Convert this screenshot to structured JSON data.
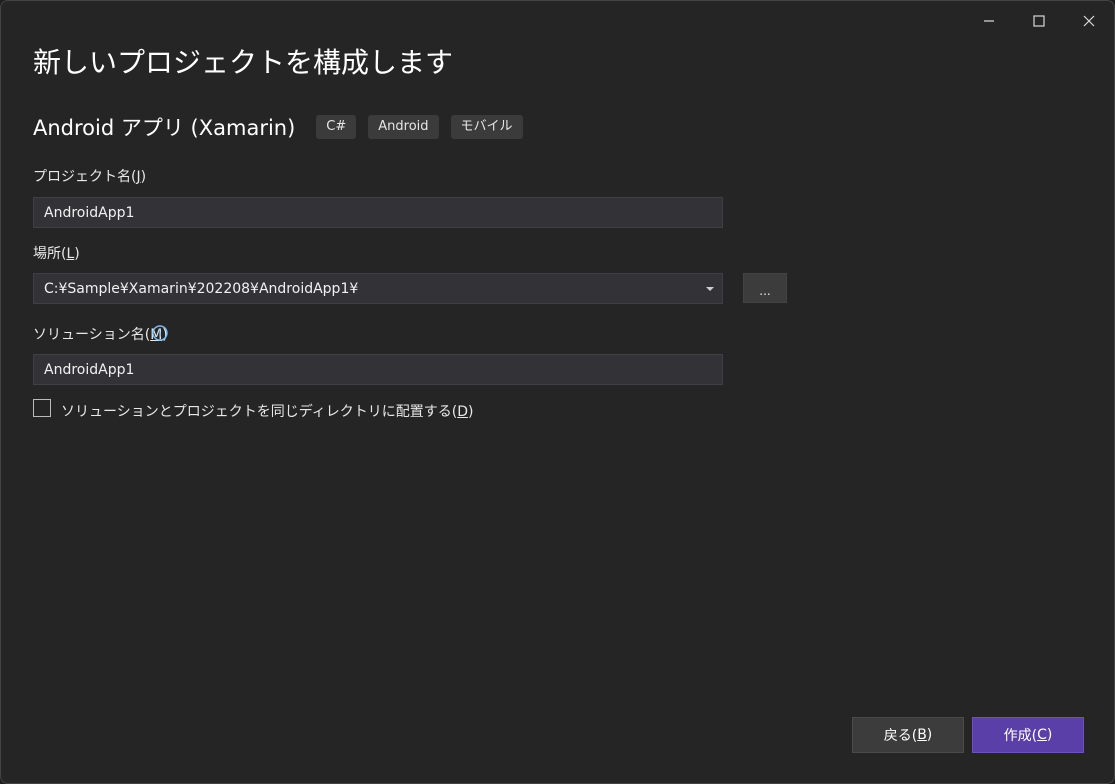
{
  "window": {
    "controls": {
      "minimize_icon": "minimize-icon",
      "maximize_icon": "maximize-icon",
      "close_icon": "close-icon"
    }
  },
  "page": {
    "title": "新しいプロジェクトを構成します"
  },
  "template": {
    "name": "Android アプリ (Xamarin)",
    "tags": [
      "C#",
      "Android",
      "モバイル"
    ]
  },
  "form": {
    "project_name": {
      "label": "プロジェクト名(",
      "mnemonic": "J",
      "label_end": ")",
      "value": "AndroidApp1"
    },
    "location": {
      "label": "場所(",
      "mnemonic": "L",
      "label_end": ")",
      "value": "C:¥Sample¥Xamarin¥202208¥AndroidApp1¥",
      "browse_label": "..."
    },
    "solution_name": {
      "label": "ソリューション名(",
      "mnemonic": "M",
      "label_end": ")",
      "value": "AndroidApp1",
      "info_icon": "info-icon"
    },
    "same_directory": {
      "label": "ソリューションとプロジェクトを同じディレクトリに配置する(",
      "mnemonic": "D",
      "label_end": ")",
      "checked": false
    }
  },
  "footer": {
    "back": {
      "label": "戻る(",
      "mnemonic": "B",
      "label_end": ")"
    },
    "create": {
      "label": "作成(",
      "mnemonic": "C",
      "label_end": ")"
    }
  },
  "colors": {
    "background": "#252526",
    "field_bg": "#333337",
    "accent": "#5b3fa8",
    "info": "#75bef8"
  }
}
